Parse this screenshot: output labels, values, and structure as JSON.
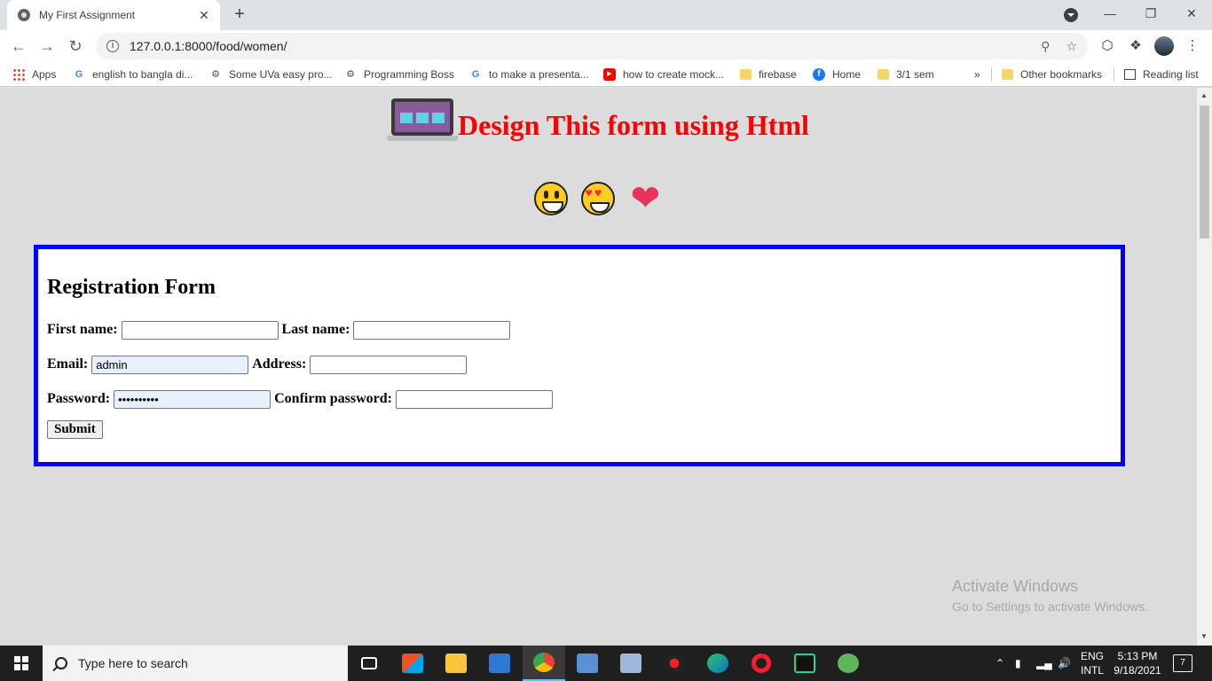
{
  "browser": {
    "tab_title": "My First Assignment",
    "tab_close": "✕",
    "new_tab": "+",
    "url": "127.0.0.1:8000/food/women/",
    "bookmarks": [
      {
        "label": "Apps",
        "icon": "apps-grid-icon"
      },
      {
        "label": "english to bangla di...",
        "icon": "google-icon"
      },
      {
        "label": "Some UVa easy pro...",
        "icon": "site-icon"
      },
      {
        "label": "Programming Boss",
        "icon": "site-icon"
      },
      {
        "label": "to make a presenta...",
        "icon": "google-icon"
      },
      {
        "label": "how to create mock...",
        "icon": "youtube-icon"
      },
      {
        "label": "firebase",
        "icon": "folder-icon"
      },
      {
        "label": "Home",
        "icon": "facebook-icon"
      },
      {
        "label": "3/1 sem",
        "icon": "folder-icon"
      }
    ],
    "bookmarks_overflow": "»",
    "other_bookmarks": "Other bookmarks",
    "reading_list": "Reading list"
  },
  "page": {
    "title": "Design This form using Html",
    "form": {
      "heading": "Registration Form",
      "first_name_label": "First name:",
      "first_name_value": "",
      "last_name_label": "Last name:",
      "last_name_value": "",
      "email_label": "Email:",
      "email_value": "admin",
      "address_label": "Address:",
      "address_value": "",
      "password_label": "Password:",
      "password_value": "••••••••••",
      "confirm_label": "Confirm password:",
      "confirm_value": "",
      "submit_label": "Submit"
    },
    "accent_color": "#0000ff",
    "title_color": "#ff0000"
  },
  "watermark": {
    "line1": "Activate Windows",
    "line2": "Go to Settings to activate Windows."
  },
  "taskbar": {
    "search_placeholder": "Type here to search",
    "lang_line1": "ENG",
    "lang_line2": "INTL",
    "time": "5:13 PM",
    "date": "9/18/2021",
    "notification_count": "7"
  }
}
